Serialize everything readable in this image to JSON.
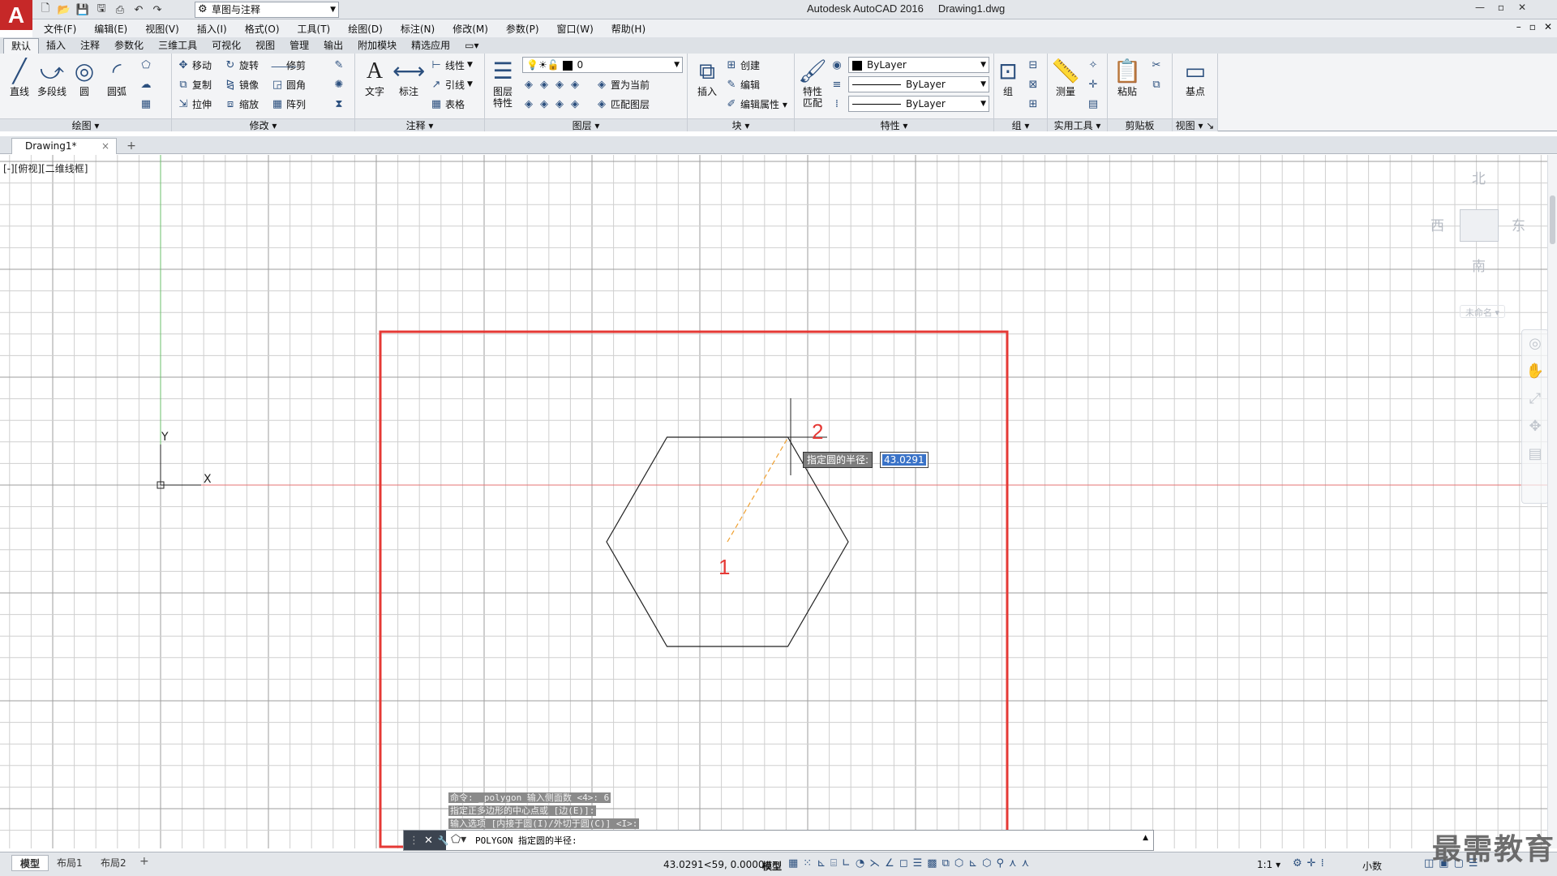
{
  "titlebar": {
    "app_logo": "A",
    "workspace": "草图与注释",
    "app_name": "Autodesk AutoCAD 2016",
    "doc_name": "Drawing1.dwg",
    "controls": [
      "—",
      "▫",
      "✕"
    ]
  },
  "menu": {
    "items": [
      "文件(F)",
      "编辑(E)",
      "视图(V)",
      "插入(I)",
      "格式(O)",
      "工具(T)",
      "绘图(D)",
      "标注(N)",
      "修改(M)",
      "参数(P)",
      "窗口(W)",
      "帮助(H)"
    ],
    "doc_controls": [
      "–",
      "▫",
      "✕"
    ]
  },
  "ribbon_tabs": [
    "默认",
    "插入",
    "注释",
    "参数化",
    "三维工具",
    "可视化",
    "视图",
    "管理",
    "输出",
    "附加模块",
    "精选应用",
    "▭▾"
  ],
  "ribbon": {
    "draw": {
      "title": "绘图 ▾",
      "line": "直线",
      "polyline": "多段线",
      "circle": "圆",
      "arc": "圆弧"
    },
    "modify": {
      "title": "修改 ▾",
      "move": "移动",
      "rotate": "旋转",
      "trim": "修剪",
      "copy": "复制",
      "mirror": "镜像",
      "fillet": "圆角",
      "stretch": "拉伸",
      "scale": "缩放",
      "array": "阵列"
    },
    "annotation": {
      "title": "注释 ▾",
      "text": "文字",
      "dimension": "标注",
      "linear": "线性",
      "leader": "引线",
      "table": "表格"
    },
    "layers": {
      "title": "图层 ▾",
      "layer_props": "图层\n特性",
      "current_layer": "0",
      "make_current": "置为当前",
      "match_layer": "匹配图层"
    },
    "block": {
      "title": "块 ▾",
      "insert": "插入",
      "create": "创建",
      "edit": "编辑",
      "edit_attr": "编辑属性 ▾"
    },
    "properties": {
      "title": "特性 ▾",
      "match": "特性\n匹配",
      "color": "ByLayer",
      "linetype": "ByLayer",
      "lineweight": "ByLayer"
    },
    "groups": {
      "title": "组 ▾",
      "group": "组"
    },
    "utilities": {
      "title": "实用工具 ▾",
      "measure": "测量"
    },
    "clipboard": {
      "title": "剪贴板",
      "paste": "粘贴"
    },
    "view": {
      "title": "视图 ▾ ↘",
      "base": "基点"
    }
  },
  "file_tabs": {
    "active": "Drawing1*",
    "close": "×",
    "add": "+"
  },
  "canvas": {
    "viewport_label": "[-][俯视][二维线框]",
    "ucs_x": "X",
    "ucs_y": "Y",
    "viewcube": {
      "north": "北",
      "south": "南",
      "east": "东",
      "west": "西",
      "wcs": "未命名 ▾"
    },
    "tooltip_label": "指定圆的半径:",
    "tooltip_value": "43.0291",
    "marker_1": "1",
    "marker_2": "2",
    "accent_red": "#e53935"
  },
  "command": {
    "history": [
      "命令: _polygon 输入侧面数 <4>: 6",
      "指定正多边形的中心点或 [边(E)]:",
      "输入选项 [内接于圆(I)/外切于圆(C)] <I>:"
    ],
    "prompt": "POLYGON 指定圆的半径:",
    "close_icon": "✕",
    "settings_icon": "🔧"
  },
  "status": {
    "layout_tabs": [
      "模型",
      "布局1",
      "布局2"
    ],
    "add": "+",
    "coords": "43.0291<59, 0.0000",
    "model": "模型",
    "scale": "1:1 ▾",
    "units": "小数",
    "watermark": "最需教育"
  }
}
